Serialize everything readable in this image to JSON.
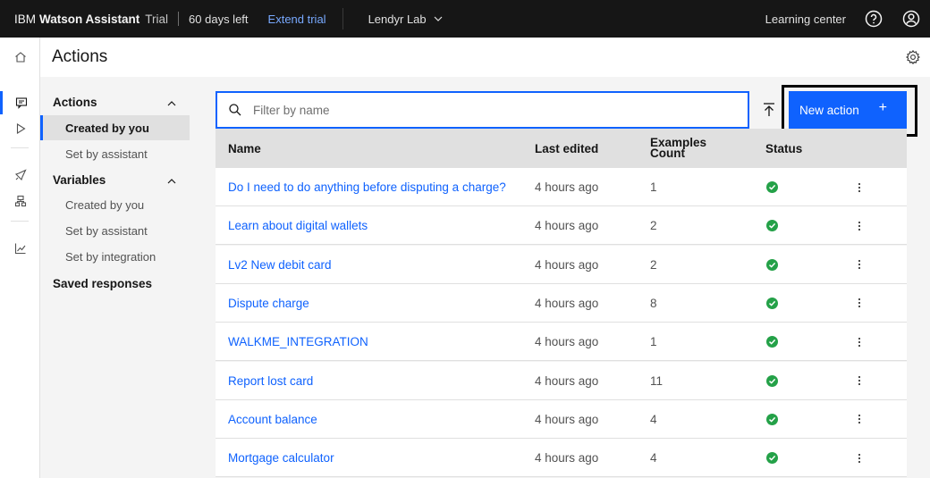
{
  "header": {
    "brand_prefix": "IBM",
    "brand_product": "Watson Assistant",
    "brand_plan": "Trial",
    "days_left": "60 days left",
    "extend_trial": "Extend trial",
    "workspace": "Lendyr Lab",
    "learning_center": "Learning center",
    "icons": [
      "help-icon",
      "user-avatar-icon"
    ]
  },
  "rail": {
    "icons": [
      "home-icon",
      "actions-chat-icon",
      "preview-play-icon",
      "publish-rocket-icon",
      "environments-icon",
      "analytics-icon"
    ],
    "active": "actions-chat-icon"
  },
  "page": {
    "title": "Actions",
    "settings_icon": "gear-icon"
  },
  "subnav": {
    "actions_heading": "Actions",
    "actions_items": [
      "Created by you",
      "Set by assistant"
    ],
    "variables_heading": "Variables",
    "variables_items": [
      "Created by you",
      "Set by assistant",
      "Set by integration"
    ],
    "saved_responses": "Saved responses",
    "active_item": "Created by you"
  },
  "toolbar": {
    "search_placeholder": "Filter by name",
    "new_action_label": "New action",
    "new_action_icon": "+",
    "upload_icon": "upload-icon"
  },
  "table": {
    "columns": {
      "name": "Name",
      "last_edited": "Last edited",
      "examples_line1": "Examples",
      "examples_line2": "Count",
      "status": "Status"
    },
    "rows": [
      {
        "name": "Do I need to do anything before disputing a charge?",
        "last_edited": "4 hours ago",
        "count": "1",
        "status": "ok"
      },
      {
        "name": "Learn about digital wallets",
        "last_edited": "4 hours ago",
        "count": "2",
        "status": "ok"
      },
      {
        "name": "Lv2 New debit card",
        "last_edited": "4 hours ago",
        "count": "2",
        "status": "ok"
      },
      {
        "name": "Dispute charge",
        "last_edited": "4 hours ago",
        "count": "8",
        "status": "ok"
      },
      {
        "name": "WALKME_INTEGRATION",
        "last_edited": "4 hours ago",
        "count": "1",
        "status": "ok"
      },
      {
        "name": "Report lost card",
        "last_edited": "4 hours ago",
        "count": "11",
        "status": "ok"
      },
      {
        "name": "Account balance",
        "last_edited": "4 hours ago",
        "count": "4",
        "status": "ok"
      },
      {
        "name": "Mortgage calculator",
        "last_edited": "4 hours ago",
        "count": "4",
        "status": "ok"
      }
    ]
  },
  "colors": {
    "accent": "#0f62fe",
    "status_ok": "#24a148",
    "header_bg": "#161616",
    "link_on_dark": "#78a9ff"
  }
}
